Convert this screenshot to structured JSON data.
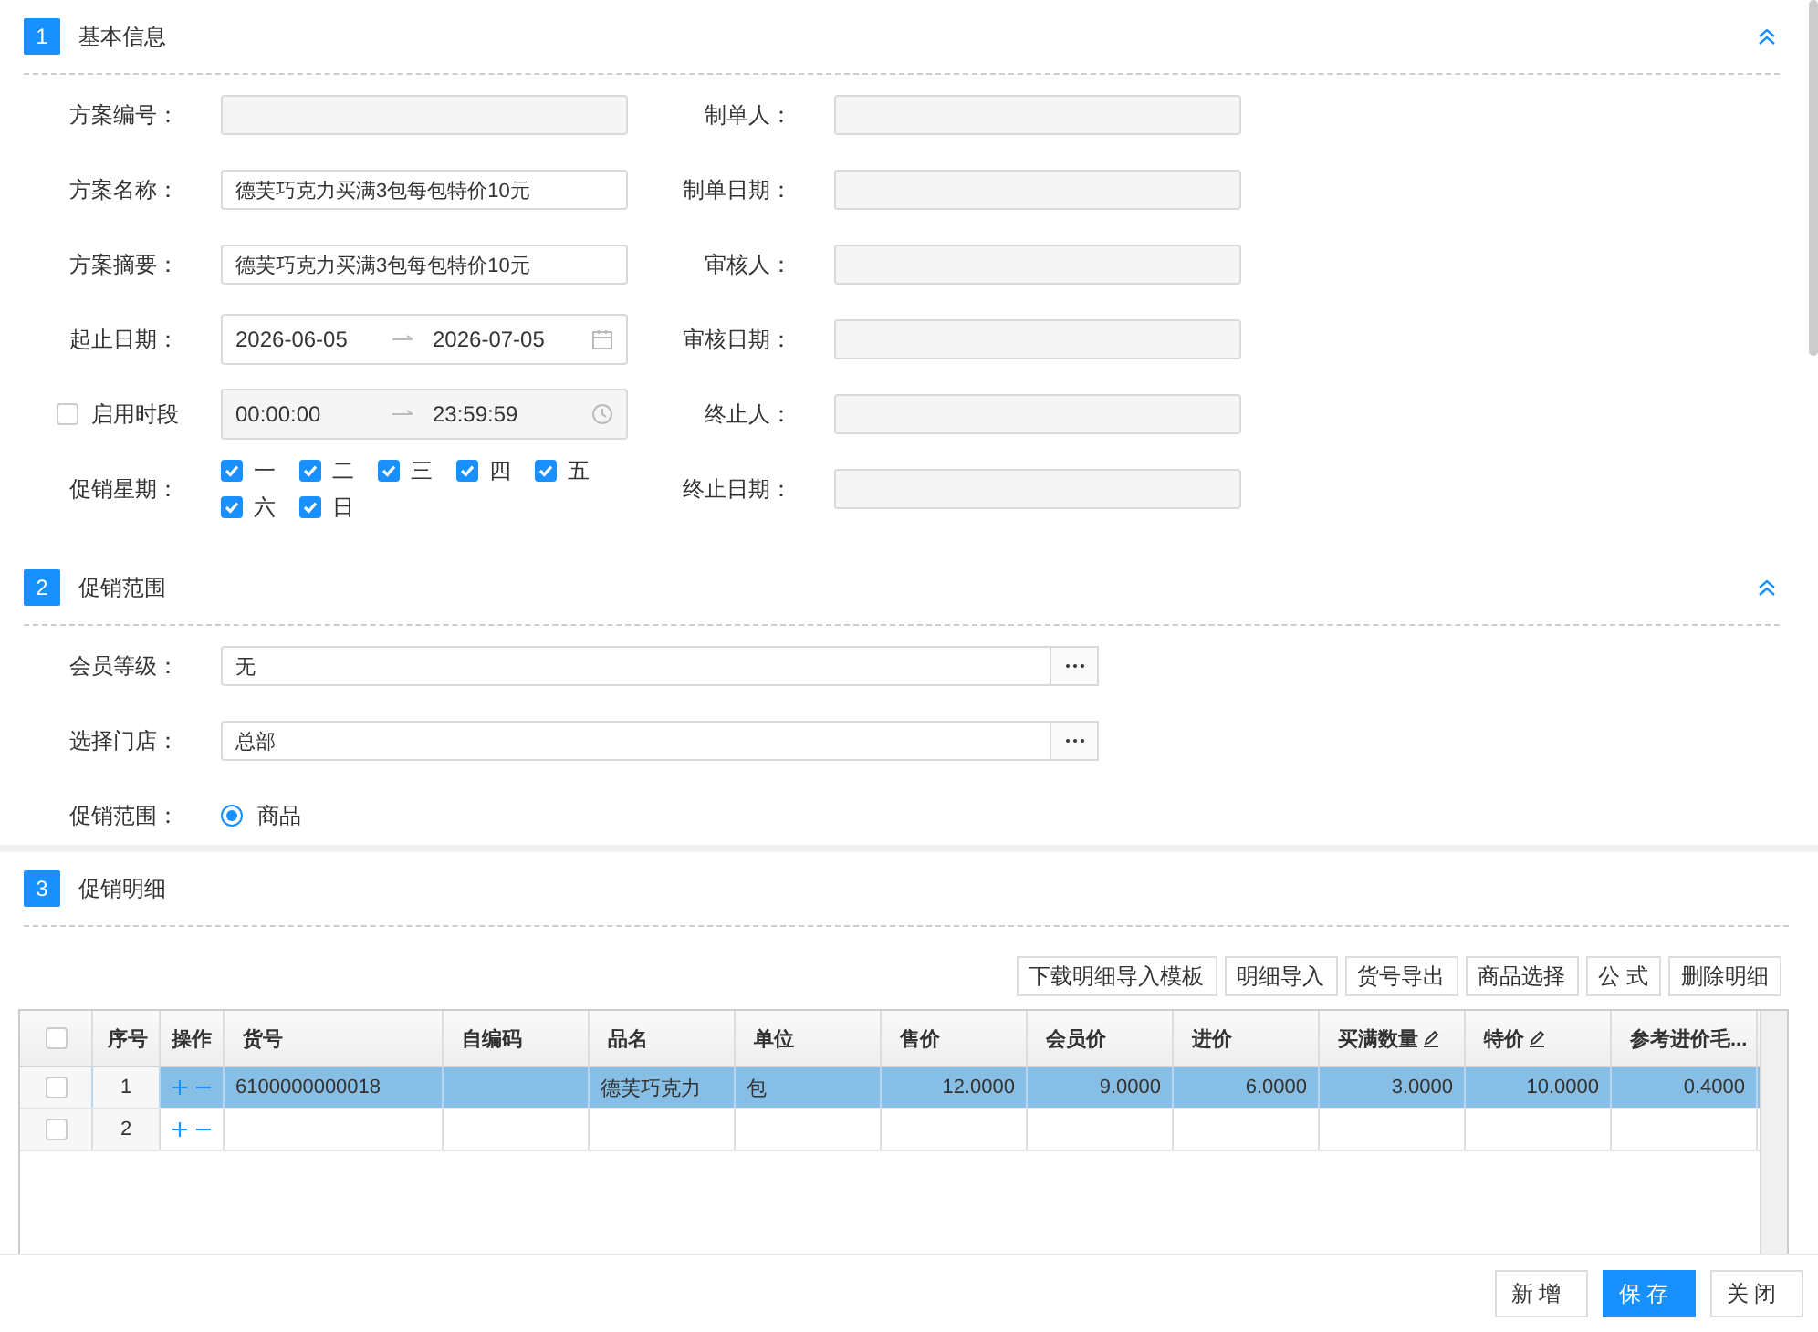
{
  "basic_info": {
    "number": "1",
    "title": "基本信息",
    "expanded": true,
    "left_fields": [
      {
        "kind": "text",
        "label": "方案编号：",
        "disabled": true
      },
      {
        "kind": "text",
        "label": "方案名称：",
        "disabled": false,
        "value": "德芙巧克力买满3包每包特价10元"
      },
      {
        "kind": "text",
        "label": "方案摘要：",
        "disabled": false,
        "value": "德芙巧克力买满3包每包特价10元"
      },
      {
        "kind": "date_range",
        "label": "起止日期：",
        "start": "2026-06-05",
        "end": "2026-07-05"
      },
      {
        "kind": "time_range",
        "label": "启用时段",
        "checked": false,
        "start": "00:00:00",
        "end": "23:59:59"
      },
      {
        "kind": "weekdays",
        "label": "促销星期：",
        "days": [
          {
            "label": "一",
            "checked": true
          },
          {
            "label": "二",
            "checked": true
          },
          {
            "label": "三",
            "checked": true
          },
          {
            "label": "四",
            "checked": true
          },
          {
            "label": "五",
            "checked": true
          },
          {
            "label": "六",
            "checked": true
          },
          {
            "label": "日",
            "checked": true
          }
        ]
      }
    ],
    "right_fields": [
      {
        "label": "制单人：",
        "disabled": true
      },
      {
        "label": "制单日期：",
        "disabled": true
      },
      {
        "label": "审核人：",
        "disabled": true
      },
      {
        "label": "审核日期：",
        "disabled": true
      },
      {
        "label": "终止人：",
        "disabled": true
      },
      {
        "label": "终止日期：",
        "disabled": true
      }
    ]
  },
  "scope": {
    "number": "2",
    "title": "促销范围",
    "expanded": true,
    "fields": [
      {
        "kind": "picker",
        "label": "会员等级：",
        "value": "无"
      },
      {
        "kind": "picker",
        "label": "选择门店：",
        "value": "总部"
      },
      {
        "kind": "radio",
        "label": "促销范围：",
        "options": [
          {
            "label": "商品",
            "selected": true
          }
        ]
      }
    ]
  },
  "details": {
    "number": "3",
    "title": "促销明细",
    "toolbar": [
      "下载明细导入模板",
      "明细导入",
      "货号导出",
      "商品选择",
      "公 式",
      "删除明细"
    ],
    "table": {
      "header_checked": false,
      "columns": [
        {
          "title": "序号",
          "kind": "index",
          "editable": false
        },
        {
          "title": "操作",
          "kind": "action",
          "editable": false
        },
        {
          "title": "货号",
          "kind": "text",
          "editable": false
        },
        {
          "title": "自编码",
          "kind": "text",
          "editable": false
        },
        {
          "title": "品名",
          "kind": "text",
          "editable": false
        },
        {
          "title": "单位",
          "kind": "text",
          "editable": false
        },
        {
          "title": "售价",
          "kind": "number",
          "editable": false
        },
        {
          "title": "会员价",
          "kind": "number",
          "editable": false
        },
        {
          "title": "进价",
          "kind": "number",
          "editable": false
        },
        {
          "title": "买满数量",
          "kind": "number",
          "editable": true
        },
        {
          "title": "特价",
          "kind": "number",
          "editable": true
        },
        {
          "title": "参考进价毛...",
          "kind": "number",
          "editable": false
        }
      ],
      "rows": [
        {
          "selected": true,
          "checked": false,
          "cells": [
            "1",
            null,
            "6100000000018",
            null,
            "德芙巧克力",
            "包",
            "12.0000",
            "9.0000",
            "6.0000",
            "3.0000",
            "10.0000",
            "0.4000"
          ]
        },
        {
          "selected": false,
          "checked": false,
          "cells": [
            "2",
            null,
            null,
            null,
            null,
            null,
            null,
            null,
            null,
            null,
            null,
            null
          ]
        }
      ]
    }
  },
  "footer_buttons": [
    {
      "label": "新增",
      "primary": false
    },
    {
      "label": "保存",
      "primary": true
    },
    {
      "label": "关闭",
      "primary": false
    }
  ]
}
